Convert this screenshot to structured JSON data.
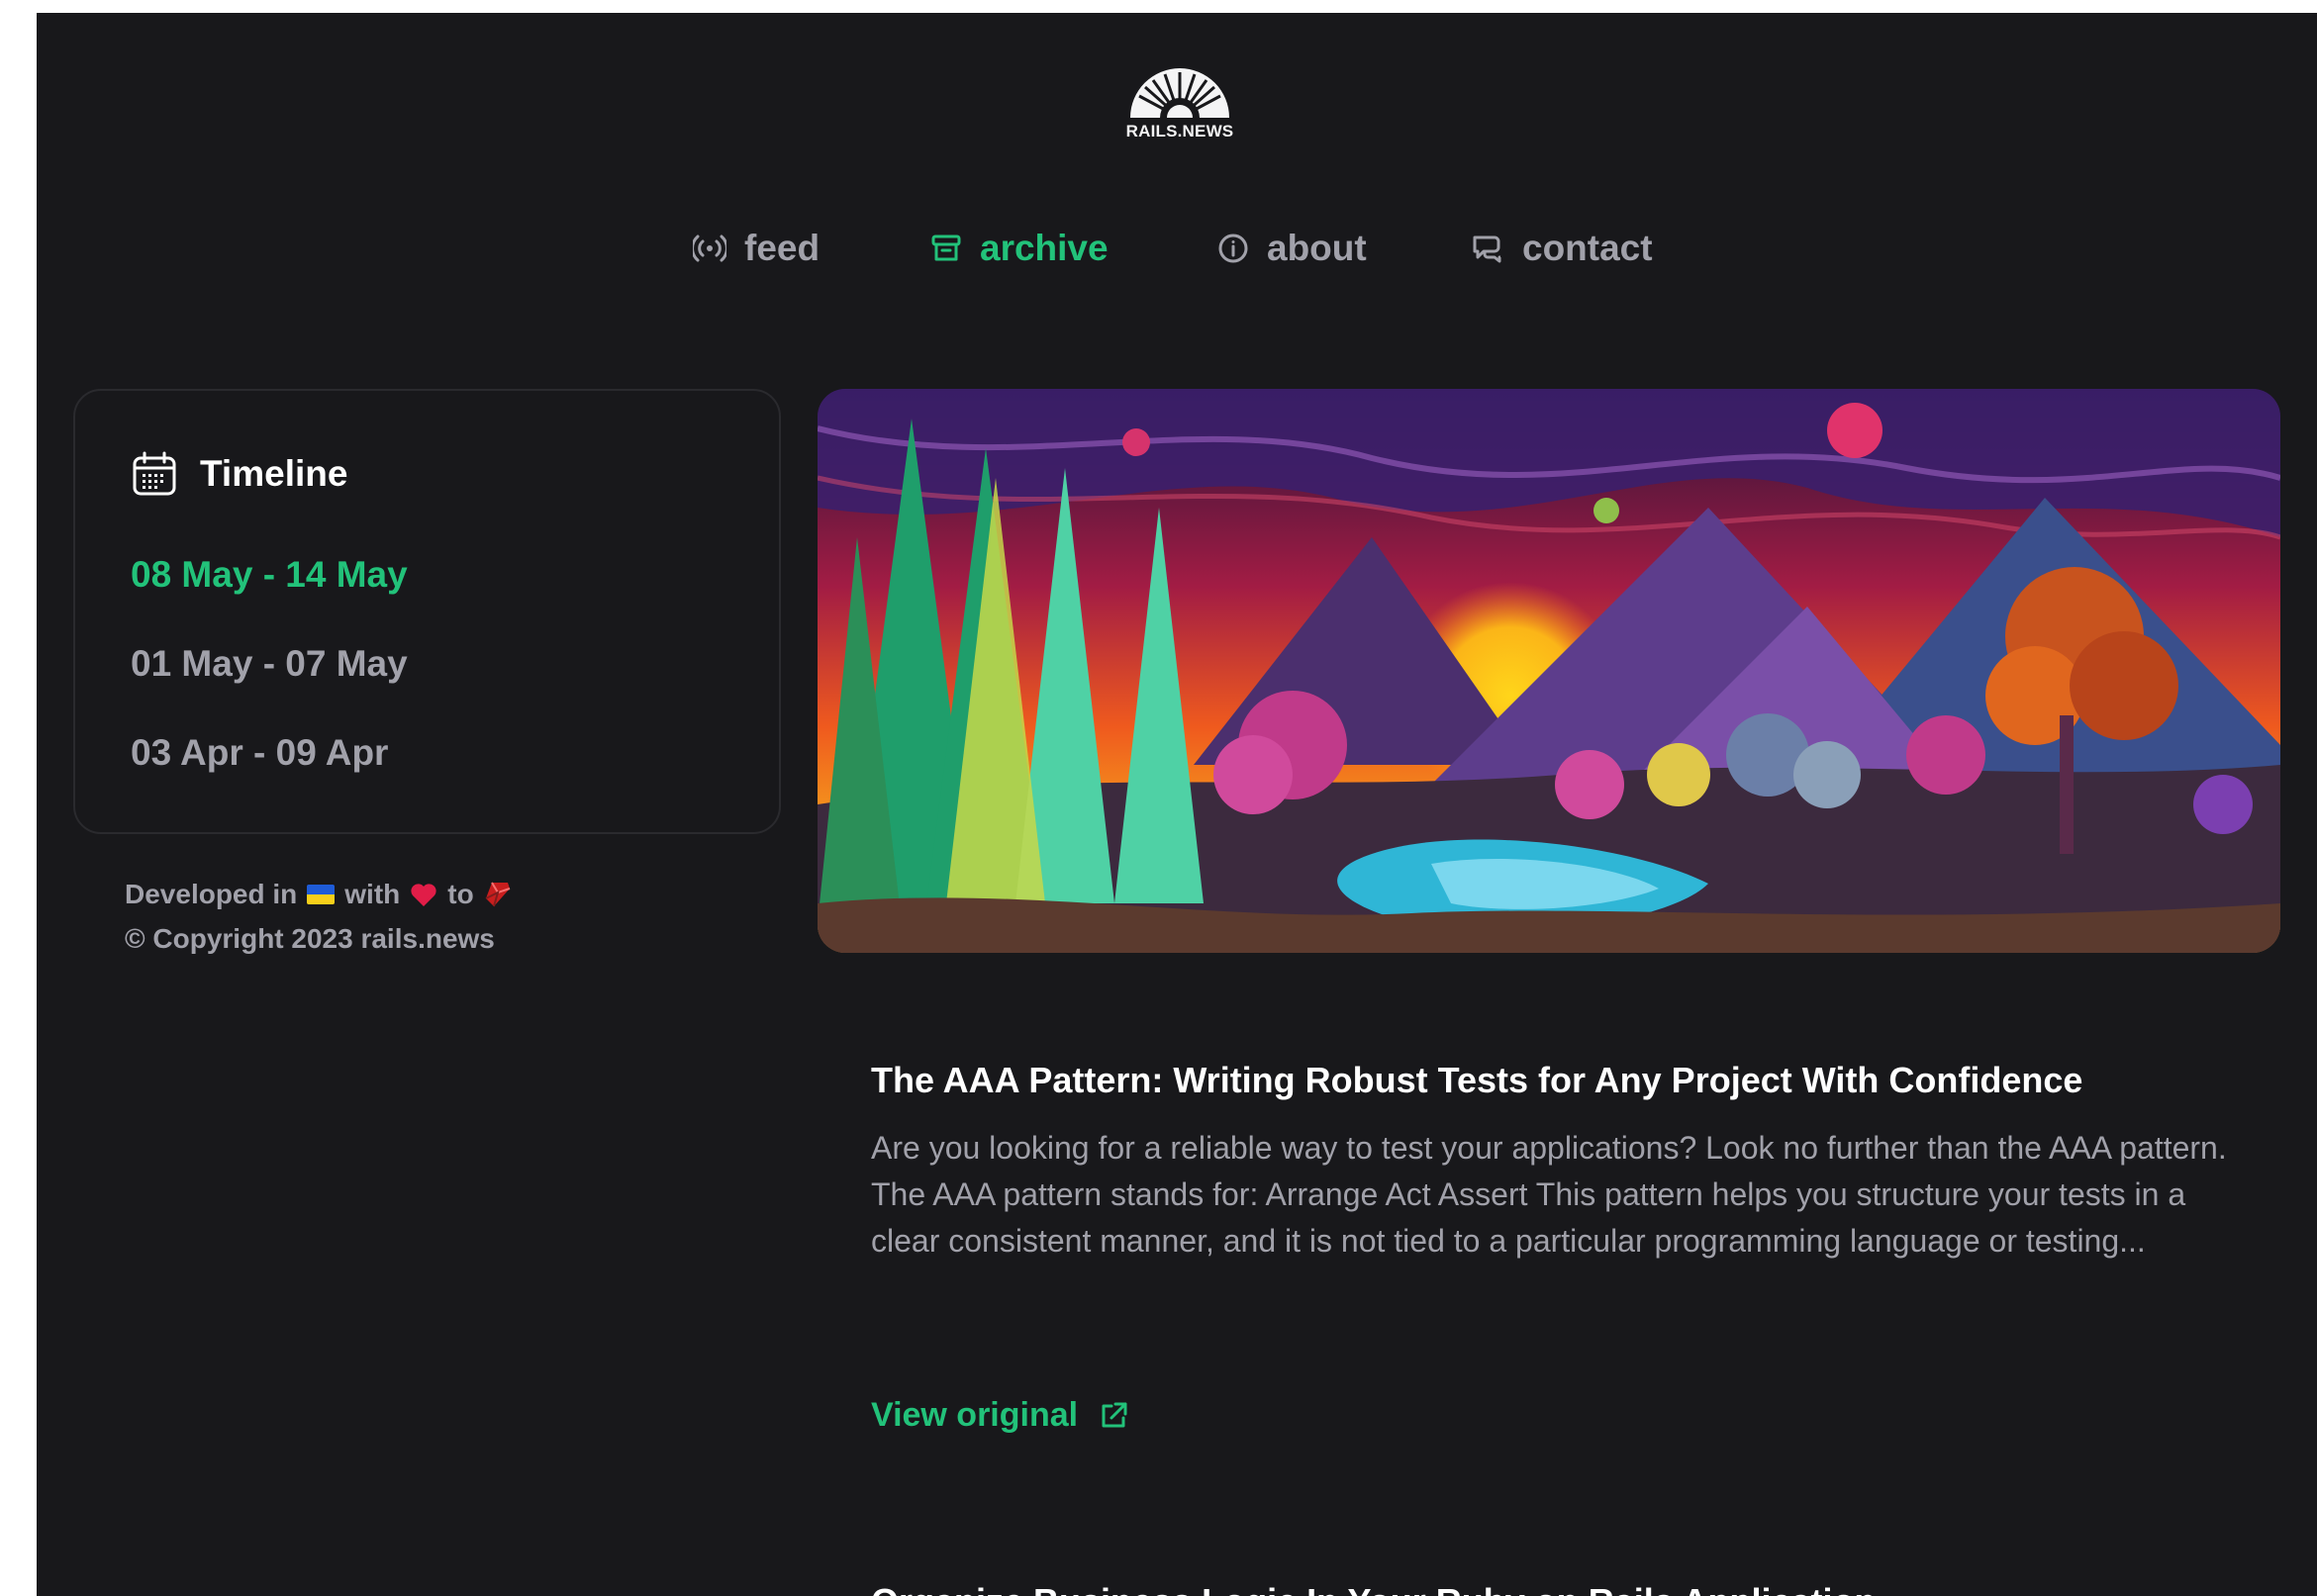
{
  "brand": {
    "logo_text": "RAILS.NEWS"
  },
  "nav": {
    "items": [
      {
        "label": "feed",
        "icon": "broadcast-icon",
        "active": false
      },
      {
        "label": "archive",
        "icon": "archive-box-icon",
        "active": true
      },
      {
        "label": "about",
        "icon": "info-circle-icon",
        "active": false
      },
      {
        "label": "contact",
        "icon": "chat-bubbles-icon",
        "active": false
      }
    ]
  },
  "sidebar": {
    "timeline_title": "Timeline",
    "timeline_icon": "calendar-icon",
    "weeks": [
      {
        "label": "08 May - 14 May",
        "active": true
      },
      {
        "label": "01 May - 07 May",
        "active": false
      },
      {
        "label": "03 Apr - 09 Apr",
        "active": false
      }
    ]
  },
  "footer": {
    "developed_in": "Developed in",
    "with": "with",
    "to": "to",
    "copyright": "© Copyright 2023 rails.news"
  },
  "article": {
    "title": "The AAA Pattern: Writing Robust Tests for Any Project With Confidence",
    "excerpt": "Are you looking for a reliable way to test your applications? Look no further than the AAA pattern. The AAA pattern stands for: Arrange Act Assert This pattern helps you structure your tests in a clear consistent manner, and it is not tied to a particular programming language or testing...",
    "view_original": "View original"
  },
  "next_article": {
    "title_partial": "Organize Business Logic In Your Ruby on Rails Application"
  },
  "colors": {
    "accent": "#22c27a",
    "background": "#18181b",
    "muted": "#a1a1aa"
  }
}
